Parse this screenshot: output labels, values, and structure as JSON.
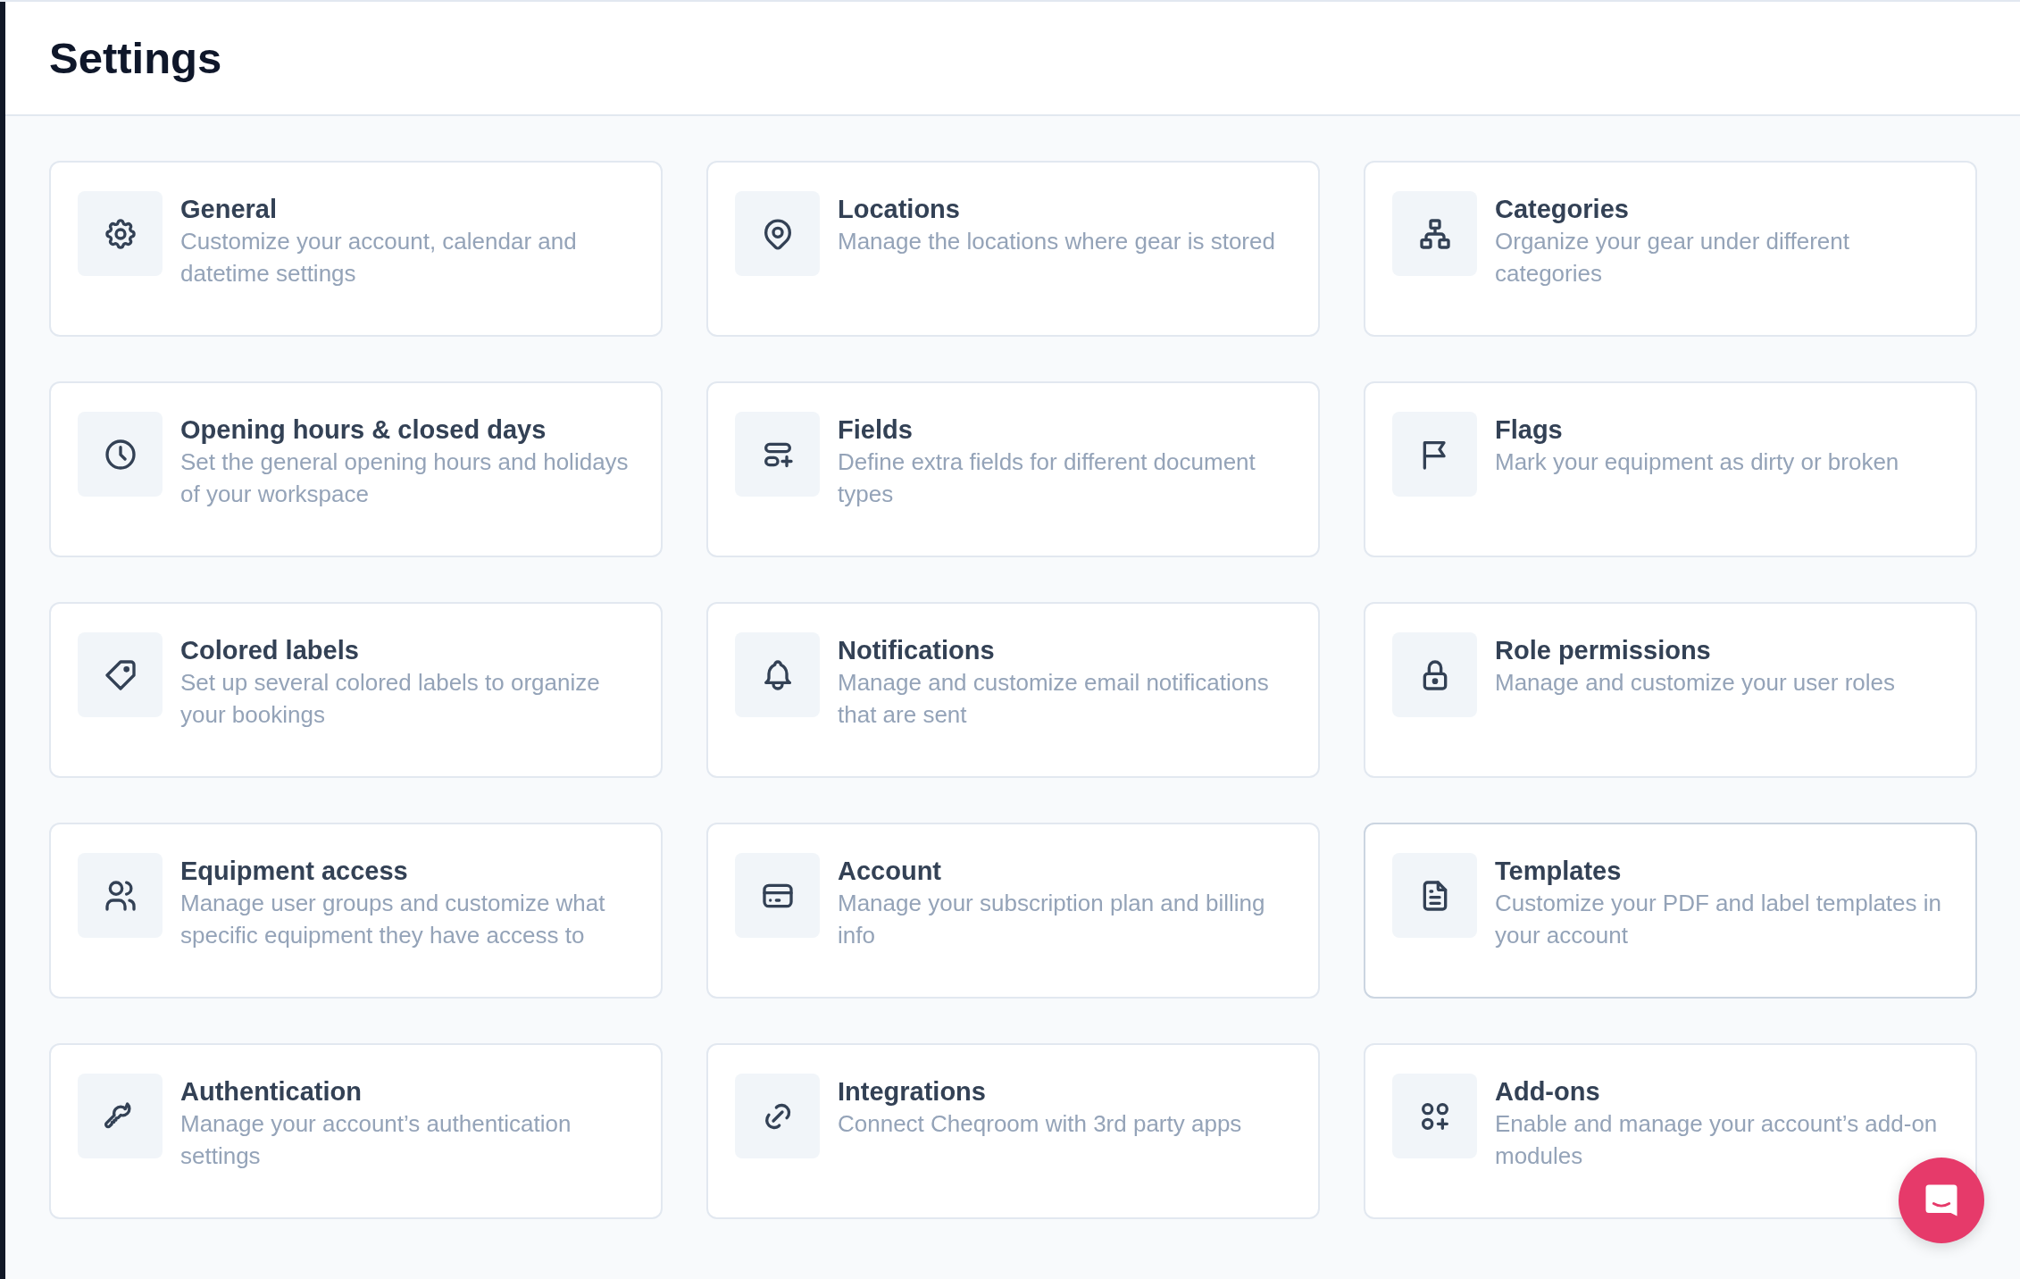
{
  "page": {
    "title": "Settings"
  },
  "cards": [
    {
      "kind": "gear",
      "title": "General",
      "description": "Customize your account, calendar and datetime settings",
      "hovered": false
    },
    {
      "kind": "pin",
      "title": "Locations",
      "description": "Manage the locations where gear is stored",
      "hovered": false
    },
    {
      "kind": "hierarchy",
      "title": "Categories",
      "description": "Organize your gear under different categories",
      "hovered": false
    },
    {
      "kind": "clock",
      "title": "Opening hours & closed days",
      "description": "Set the general opening hours and holidays of your workspace",
      "hovered": false
    },
    {
      "kind": "fields",
      "title": "Fields",
      "description": "Define extra fields for different document types",
      "hovered": false
    },
    {
      "kind": "flag",
      "title": "Flags",
      "description": "Mark your equipment as dirty or broken",
      "hovered": false
    },
    {
      "kind": "tag",
      "title": "Colored labels",
      "description": "Set up several colored labels to organize your bookings",
      "hovered": false
    },
    {
      "kind": "bell",
      "title": "Notifications",
      "description": "Manage and customize email notifications that are sent",
      "hovered": false
    },
    {
      "kind": "lock",
      "title": "Role permissions",
      "description": "Manage and customize your user roles",
      "hovered": false
    },
    {
      "kind": "users",
      "title": "Equipment access",
      "description": "Manage user groups and customize what specific equipment they have access to",
      "hovered": false
    },
    {
      "kind": "card",
      "title": "Account",
      "description": "Manage your subscription plan and billing info",
      "hovered": false
    },
    {
      "kind": "file",
      "title": "Templates",
      "description": "Customize your PDF and label templates in your account",
      "hovered": true
    },
    {
      "kind": "key",
      "title": "Authentication",
      "description": "Manage your account’s authentication settings",
      "hovered": false
    },
    {
      "kind": "link",
      "title": "Integrations",
      "description": "Connect Cheqroom with 3rd party apps",
      "hovered": false
    },
    {
      "kind": "apps",
      "title": "Add-ons",
      "description": "Enable and manage your account’s add-on modules",
      "hovered": false
    }
  ]
}
